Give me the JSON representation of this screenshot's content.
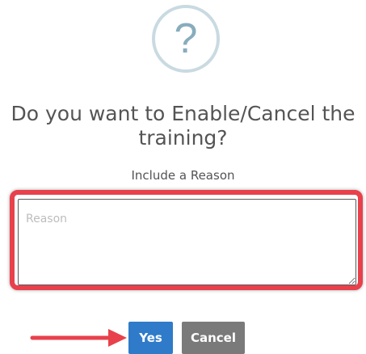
{
  "dialog": {
    "icon": "question-mark-icon",
    "icon_glyph": "?",
    "title_line1": "Do you want to Enable/Cancel the",
    "title_line2": "training?",
    "reason_label": "Include a Reason",
    "reason_placeholder": "Reason",
    "reason_value": "",
    "yes_label": "Yes",
    "cancel_label": "Cancel"
  },
  "annotations": {
    "highlight_color": "#e8414c",
    "arrow_color": "#e8414c"
  },
  "colors": {
    "title": "#545454",
    "icon_ring": "#c9dae1",
    "icon_glyph": "#87adbd",
    "yes_button": "#2f7bc9",
    "cancel_button": "#7a7a7a"
  }
}
